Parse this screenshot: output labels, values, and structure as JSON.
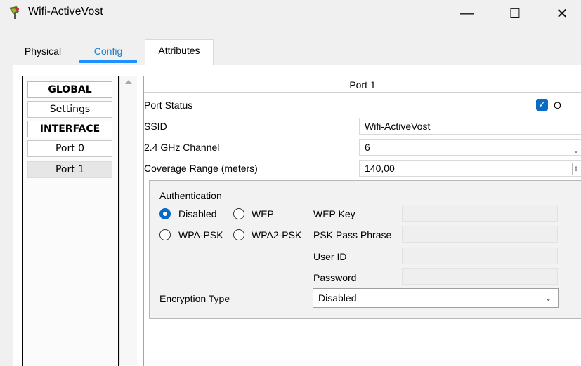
{
  "window": {
    "title": "Wifi-ActiveVost",
    "minimize_glyph": "—",
    "maximize_glyph": "☐",
    "close_glyph": "✕"
  },
  "tabs": [
    {
      "label": "Physical"
    },
    {
      "label": "Config",
      "active": true
    },
    {
      "label": "Attributes"
    }
  ],
  "sidebar": {
    "items": [
      {
        "label": "GLOBAL",
        "type": "header"
      },
      {
        "label": "Settings"
      },
      {
        "label": "INTERFACE",
        "type": "header"
      },
      {
        "label": "Port 0"
      },
      {
        "label": "Port 1",
        "selected": true
      }
    ]
  },
  "port": {
    "title": "Port 1",
    "port_status_label": "Port Status",
    "port_status_checked": true,
    "port_status_text": "O",
    "ssid_label": "SSID",
    "ssid_value": "Wifi-ActiveVost",
    "channel_label": "2.4 GHz Channel",
    "channel_value": "6",
    "coverage_label": "Coverage Range (meters)",
    "coverage_value": "140,00"
  },
  "auth": {
    "title": "Authentication",
    "options": [
      {
        "label": "Disabled",
        "selected": true
      },
      {
        "label": "WEP"
      },
      {
        "label": "WPA-PSK"
      },
      {
        "label": "WPA2-PSK"
      }
    ],
    "wep_key_label": "WEP Key",
    "psk_label": "PSK Pass Phrase",
    "user_id_label": "User ID",
    "password_label": "Password",
    "encryption_label": "Encryption Type",
    "encryption_value": "Disabled"
  },
  "colors": {
    "accent": "#1e90ff",
    "checkbox": "#0b6bc2"
  },
  "icons": {
    "app": "packet-tracer-device-icon",
    "checkbox": "checkmark-icon",
    "dropdown": "chevron-down-icon"
  }
}
